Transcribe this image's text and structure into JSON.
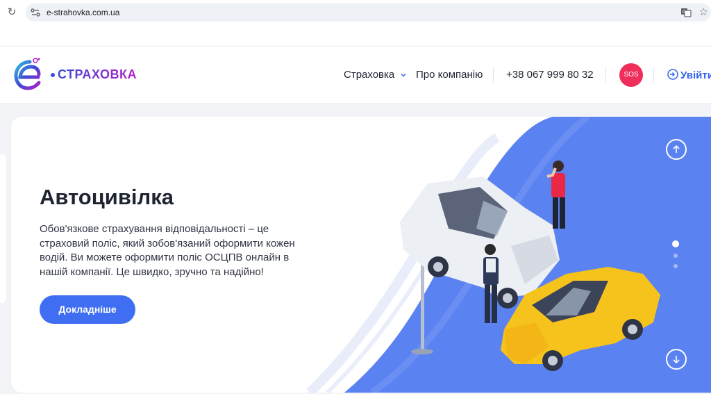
{
  "browser": {
    "url": "e-strahovka.com.ua",
    "icons": [
      "reload-icon",
      "site-info-icon",
      "translate-icon",
      "star-icon"
    ]
  },
  "header": {
    "logo_text": "СТРАХОВКА",
    "nav": {
      "insurance": "Страховка",
      "about": "Про компанію"
    },
    "phone": "+38 067 999 80 32",
    "sos_label": "SOS",
    "login_label": "Увійти"
  },
  "hero": {
    "title": "Автоцивілка",
    "description": "Обов'язкове страхування відповідальності – це страховий поліс, який зобов'язаний оформити кожен водій. Ви можете оформити поліс ОСЦПВ онлайн в нашій компанії. Це швидко, зручно та надійно!",
    "button_label": "Докладніше",
    "slides": {
      "count": 3,
      "active": 1
    }
  },
  "colors": {
    "accent": "#3f6ef2",
    "hero_blue": "#5b82f1",
    "sos": "#ef2e5b",
    "logo_purple": "#b21ec8"
  }
}
